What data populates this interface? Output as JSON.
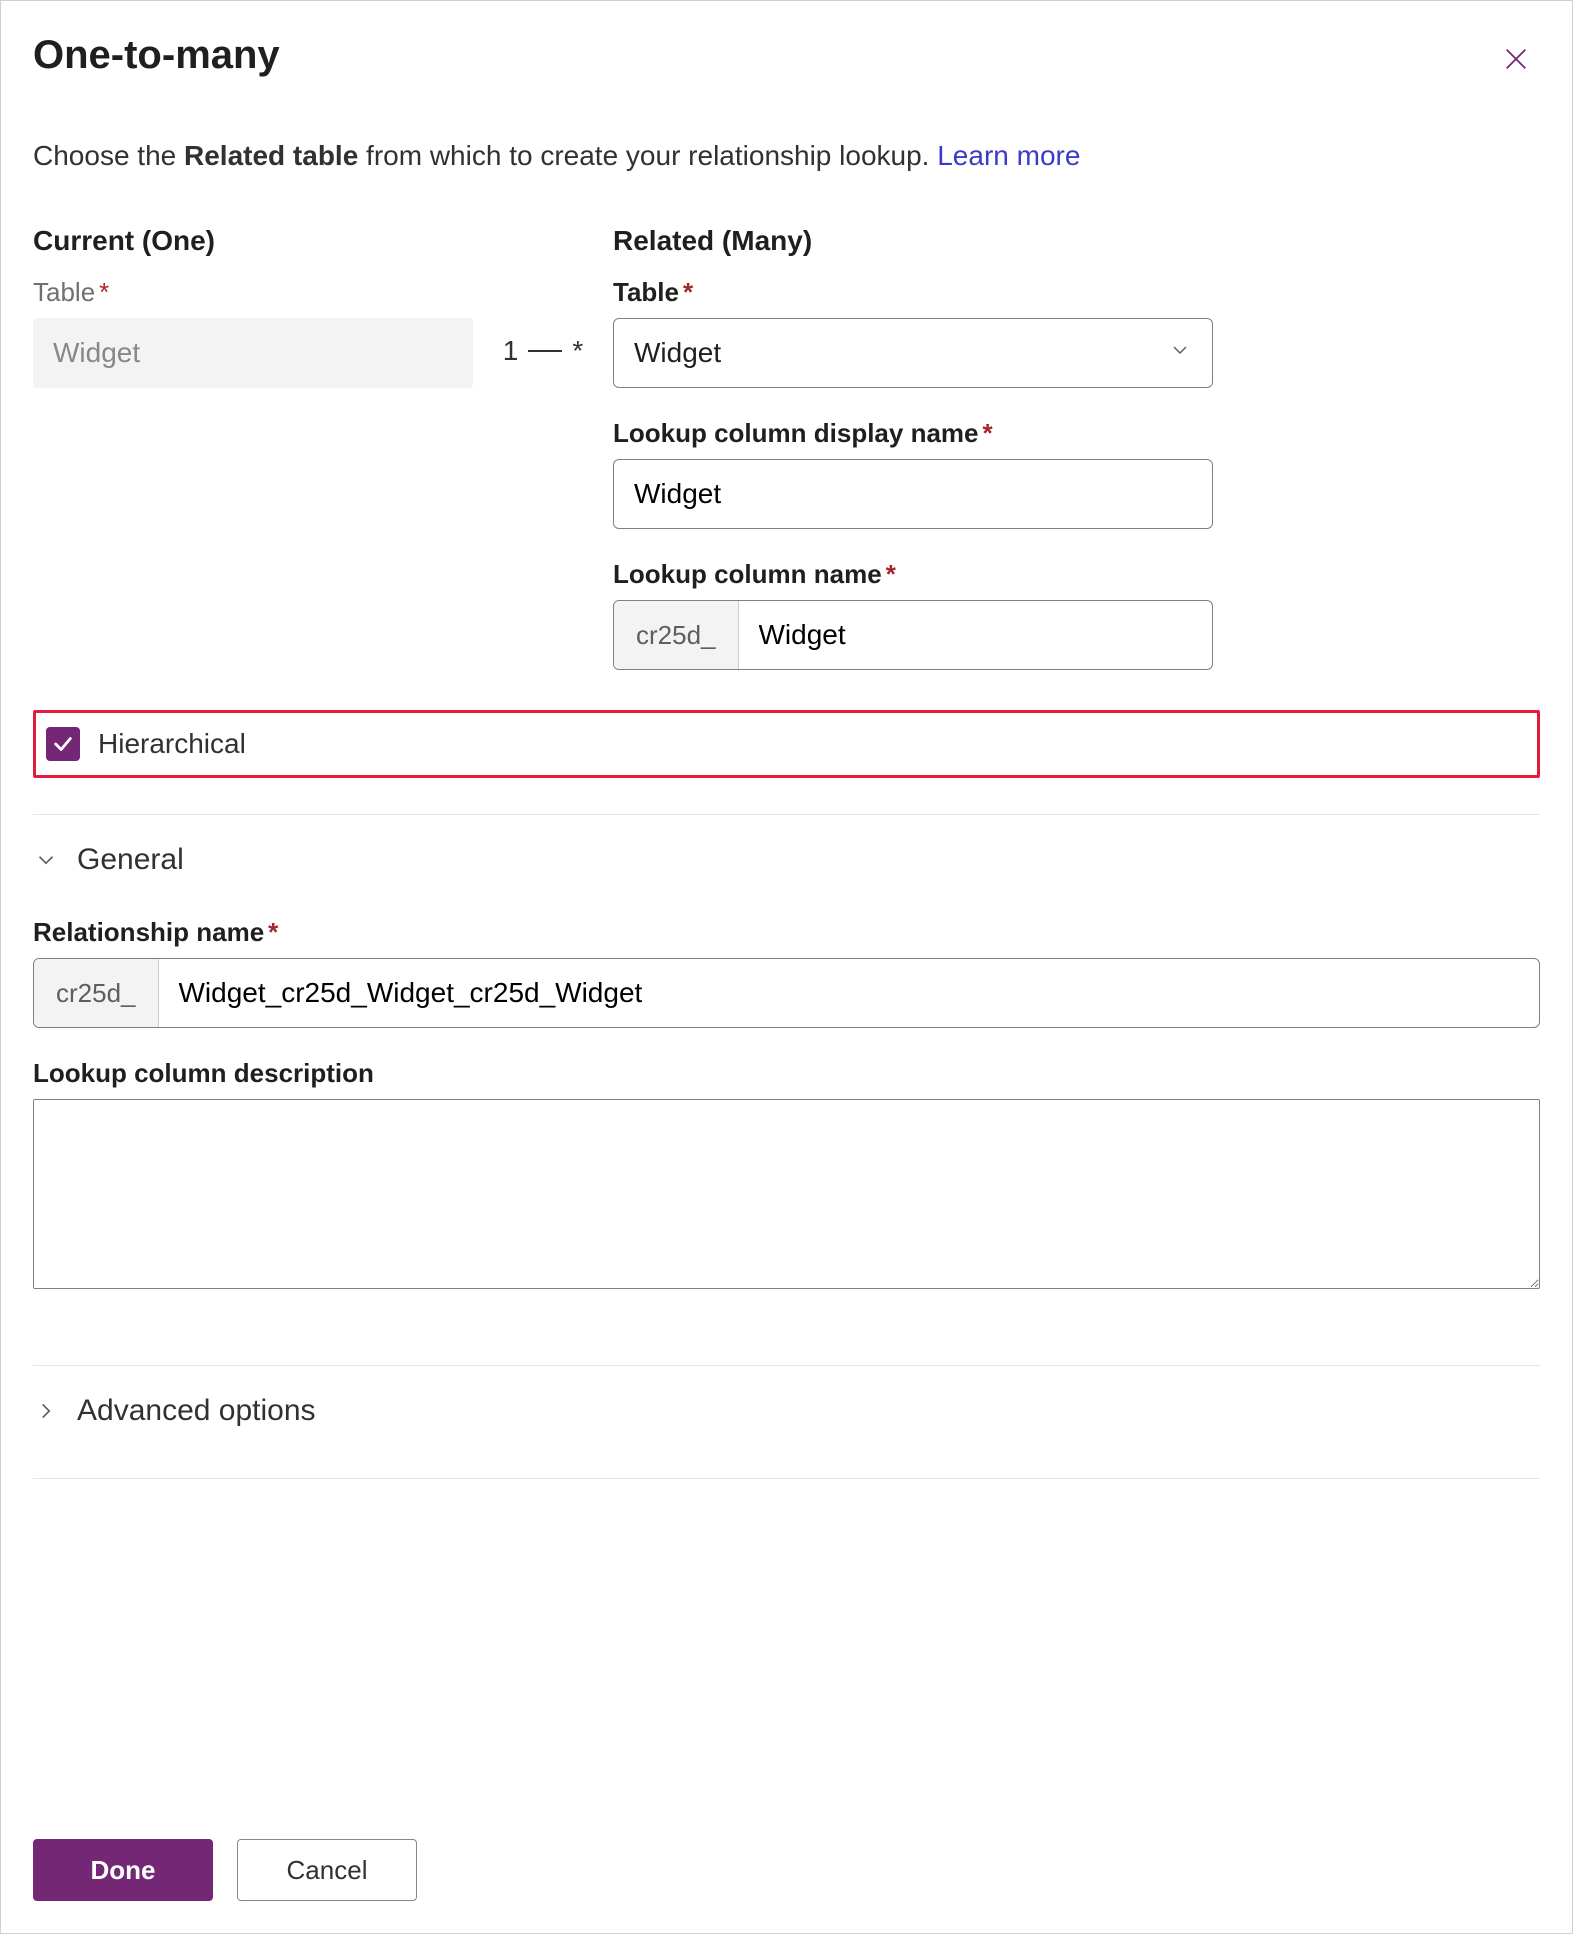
{
  "header": {
    "title": "One-to-many"
  },
  "intro": {
    "prefix": "Choose the ",
    "bold": "Related table",
    "suffix": " from which to create your relationship lookup. ",
    "link": "Learn more"
  },
  "current": {
    "heading": "Current (One)",
    "table_label": "Table",
    "table_value": "Widget"
  },
  "connector": {
    "one": "1",
    "many": "*"
  },
  "related": {
    "heading": "Related (Many)",
    "table_label": "Table",
    "table_value": "Widget",
    "lookup_display_label": "Lookup column display name",
    "lookup_display_value": "Widget",
    "lookup_name_label": "Lookup column name",
    "lookup_name_prefix": "cr25d_",
    "lookup_name_value": "Widget"
  },
  "hierarchical": {
    "label": "Hierarchical",
    "checked": true
  },
  "sections": {
    "general_label": "General",
    "advanced_label": "Advanced options"
  },
  "general": {
    "relationship_name_label": "Relationship name",
    "relationship_name_prefix": "cr25d_",
    "relationship_name_value": "Widget_cr25d_Widget_cr25d_Widget",
    "lookup_desc_label": "Lookup column description",
    "lookup_desc_value": ""
  },
  "footer": {
    "done": "Done",
    "cancel": "Cancel"
  }
}
